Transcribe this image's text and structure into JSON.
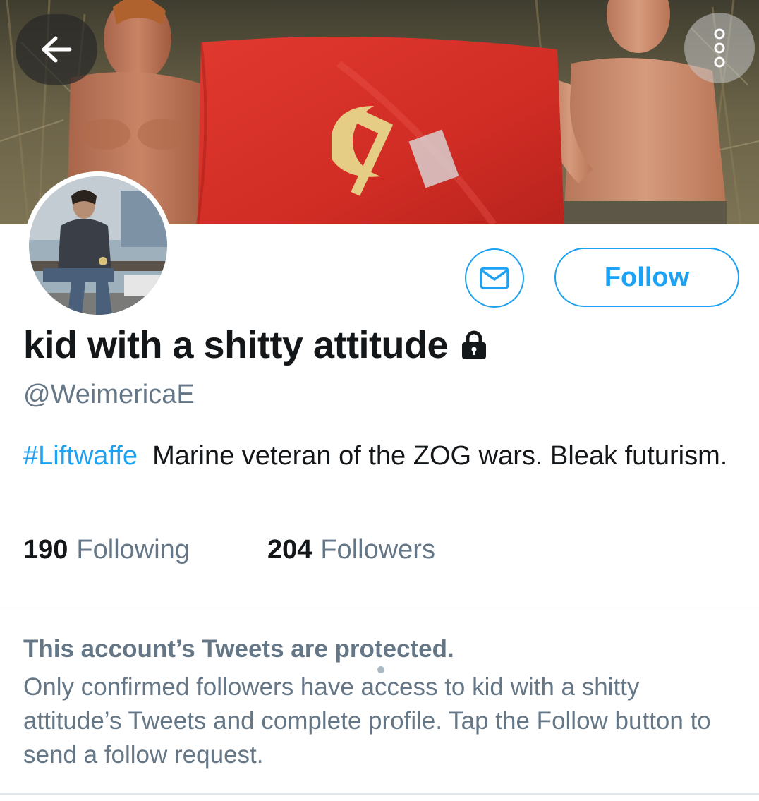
{
  "header": {
    "back_icon": "arrow-left-icon",
    "more_icon": "more-dots-vertical-icon"
  },
  "profile": {
    "display_name": "kid with a shitty attitude",
    "lock_icon": "lock-icon",
    "handle": "@WeimericaE",
    "bio_hashtag": "#Liftwaffe",
    "bio_text": "Marine veteran of the ZOG wars. Bleak futurism."
  },
  "actions": {
    "message_icon": "envelope-icon",
    "follow_label": "Follow"
  },
  "stats": {
    "following_count": "190",
    "following_label": "Following",
    "followers_count": "204",
    "followers_label": "Followers"
  },
  "protected_notice": {
    "title": "This account’s Tweets are protected.",
    "body": "Only confirmed followers have access to kid with a shitty attitude’s Tweets and complete profile. Tap the Follow button to send a follow request."
  },
  "colors": {
    "accent": "#1da1f2",
    "text_primary": "#14171a",
    "text_secondary": "#657786",
    "banner_flag": "#d8322c"
  }
}
